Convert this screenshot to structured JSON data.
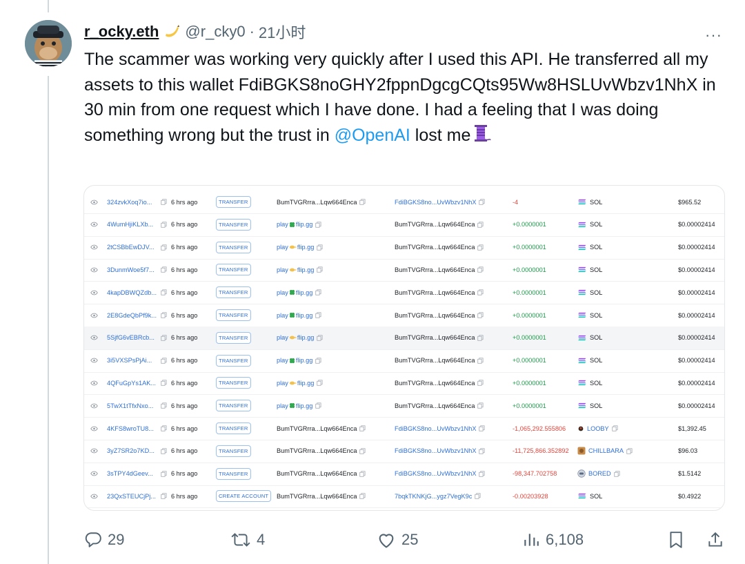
{
  "post": {
    "display_name": "r_ocky.eth",
    "handle": "@r_cky0",
    "dot": "·",
    "time": "21小时",
    "more": "···",
    "text_1": "The scammer was working very quickly after I used this API. He transferred all my assets to this wallet FdiBGKS8noGHY2fppnDgcgCQts95Ww8HSLUvWbzv1NhX in 30 min from one request which I have done. I had a feeling that I was doing something wrong but the trust in ",
    "mention": "@OpenAI",
    "text_2": " lost me"
  },
  "table": {
    "rows": [
      {
        "sig": "324zvkXoq7io...",
        "time": "6 hrs ago",
        "type": "TRANSFER",
        "from": "BumTVGRrra...Lqw664Enca",
        "from_link": false,
        "from_icon": "",
        "to": "FdiBGKS8no...UvWbzv1NhX",
        "to_link": true,
        "amount": "-4",
        "amount_color": "red",
        "token": "SOL",
        "token_icon": "sol",
        "token_link": false,
        "value": "$965.52",
        "highlight": false
      },
      {
        "sig": "4WumHjiKLXb...",
        "time": "6 hrs ago",
        "type": "TRANSFER",
        "from": "play flip.gg",
        "from_link": true,
        "from_icon": "green",
        "to": "BumTVGRrra...Lqw664Enca",
        "to_link": false,
        "amount": "+0.0000001",
        "amount_color": "green",
        "token": "SOL",
        "token_icon": "sol",
        "token_link": false,
        "value": "$0.00002414",
        "highlight": false
      },
      {
        "sig": "2tCSBbEwDJV...",
        "time": "6 hrs ago",
        "type": "TRANSFER",
        "from": "play flip.gg",
        "from_link": true,
        "from_icon": "yellow",
        "to": "BumTVGRrra...Lqw664Enca",
        "to_link": false,
        "amount": "+0.0000001",
        "amount_color": "green",
        "token": "SOL",
        "token_icon": "sol",
        "token_link": false,
        "value": "$0.00002414",
        "highlight": false
      },
      {
        "sig": "3DunmWoe5f7...",
        "time": "6 hrs ago",
        "type": "TRANSFER",
        "from": "play flip.gg",
        "from_link": true,
        "from_icon": "yellow",
        "to": "BumTVGRrra...Lqw664Enca",
        "to_link": false,
        "amount": "+0.0000001",
        "amount_color": "green",
        "token": "SOL",
        "token_icon": "sol",
        "token_link": false,
        "value": "$0.00002414",
        "highlight": false
      },
      {
        "sig": "4kapDBWQZdb...",
        "time": "6 hrs ago",
        "type": "TRANSFER",
        "from": "play flip.gg",
        "from_link": true,
        "from_icon": "green",
        "to": "BumTVGRrra...Lqw664Enca",
        "to_link": false,
        "amount": "+0.0000001",
        "amount_color": "green",
        "token": "SOL",
        "token_icon": "sol",
        "token_link": false,
        "value": "$0.00002414",
        "highlight": false
      },
      {
        "sig": "2E8GdeQbPf9k...",
        "time": "6 hrs ago",
        "type": "TRANSFER",
        "from": "play flip.gg",
        "from_link": true,
        "from_icon": "green",
        "to": "BumTVGRrra...Lqw664Enca",
        "to_link": false,
        "amount": "+0.0000001",
        "amount_color": "green",
        "token": "SOL",
        "token_icon": "sol",
        "token_link": false,
        "value": "$0.00002414",
        "highlight": false
      },
      {
        "sig": "5SjfG6vEBRcb...",
        "time": "6 hrs ago",
        "type": "TRANSFER",
        "from": "play flip.gg",
        "from_link": true,
        "from_icon": "yellow",
        "to": "BumTVGRrra...Lqw664Enca",
        "to_link": false,
        "amount": "+0.0000001",
        "amount_color": "green",
        "token": "SOL",
        "token_icon": "sol",
        "token_link": false,
        "value": "$0.00002414",
        "highlight": true
      },
      {
        "sig": "3i5VXSPsPjAi...",
        "time": "6 hrs ago",
        "type": "TRANSFER",
        "from": "play flip.gg",
        "from_link": true,
        "from_icon": "green",
        "to": "BumTVGRrra...Lqw664Enca",
        "to_link": false,
        "amount": "+0.0000001",
        "amount_color": "green",
        "token": "SOL",
        "token_icon": "sol",
        "token_link": false,
        "value": "$0.00002414",
        "highlight": false
      },
      {
        "sig": "4QFuGpYs1AK...",
        "time": "6 hrs ago",
        "type": "TRANSFER",
        "from": "play flip.gg",
        "from_link": true,
        "from_icon": "yellow",
        "to": "BumTVGRrra...Lqw664Enca",
        "to_link": false,
        "amount": "+0.0000001",
        "amount_color": "green",
        "token": "SOL",
        "token_icon": "sol",
        "token_link": false,
        "value": "$0.00002414",
        "highlight": false
      },
      {
        "sig": "5TwX1tTfxNxo...",
        "time": "6 hrs ago",
        "type": "TRANSFER",
        "from": "play flip.gg",
        "from_link": true,
        "from_icon": "green",
        "to": "BumTVGRrra...Lqw664Enca",
        "to_link": false,
        "amount": "+0.0000001",
        "amount_color": "green",
        "token": "SOL",
        "token_icon": "sol",
        "token_link": false,
        "value": "$0.00002414",
        "highlight": false
      },
      {
        "sig": "4KFS8wroTU8...",
        "time": "6 hrs ago",
        "type": "TRANSFER",
        "from": "BumTVGRrra...Lqw664Enca",
        "from_link": false,
        "from_icon": "",
        "to": "FdiBGKS8no...UvWbzv1NhX",
        "to_link": true,
        "amount": "-1,065,292.555806",
        "amount_color": "red",
        "token": "LOOBY",
        "token_icon": "looby",
        "token_link": true,
        "value": "$1,392.45",
        "highlight": false
      },
      {
        "sig": "3yZ7SR2o7KD...",
        "time": "6 hrs ago",
        "type": "TRANSFER",
        "from": "BumTVGRrra...Lqw664Enca",
        "from_link": false,
        "from_icon": "",
        "to": "FdiBGKS8no...UvWbzv1NhX",
        "to_link": true,
        "amount": "-11,725,866.352892",
        "amount_color": "red",
        "token": "CHILLBARA",
        "token_icon": "chillbara",
        "token_link": true,
        "value": "$96.03",
        "highlight": false
      },
      {
        "sig": "3sTPY4dGeev...",
        "time": "6 hrs ago",
        "type": "TRANSFER",
        "from": "BumTVGRrra...Lqw664Enca",
        "from_link": false,
        "from_icon": "",
        "to": "FdiBGKS8no...UvWbzv1NhX",
        "to_link": true,
        "amount": "-98,347.702758",
        "amount_color": "red",
        "token": "BORED",
        "token_icon": "bored",
        "token_link": true,
        "value": "$1.5142",
        "highlight": false
      },
      {
        "sig": "23QxSTEUCjPj...",
        "time": "6 hrs ago",
        "type": "CREATE ACCOUNT",
        "from": "BumTVGRrra...Lqw664Enca",
        "from_link": false,
        "from_icon": "",
        "to": "7bqkTKNKjG...ygz7VegK9c",
        "to_link": true,
        "amount": "-0.00203928",
        "amount_color": "red",
        "token": "SOL",
        "token_icon": "sol",
        "token_link": false,
        "value": "$0.4922",
        "highlight": false
      }
    ]
  },
  "actions": {
    "replies": "29",
    "reposts": "4",
    "likes": "25",
    "views": "6,108"
  },
  "colors": {
    "link": "#1d9bf0",
    "table_link": "#2f6fd6",
    "positive": "#1e9a4b",
    "negative": "#e0463d",
    "muted": "#536471"
  }
}
